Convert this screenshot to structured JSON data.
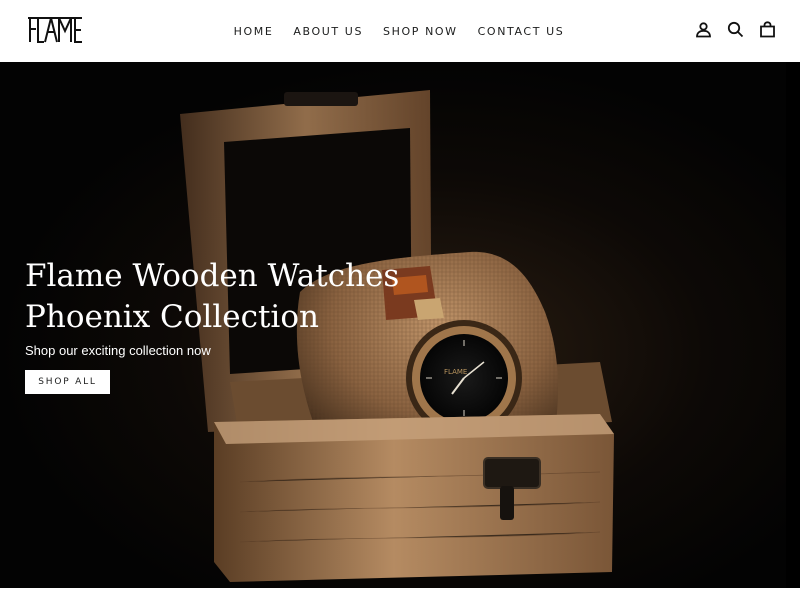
{
  "brand": {
    "logo_text": "FLAME",
    "logo_icon": "flame-logo"
  },
  "nav": {
    "items": [
      {
        "label": "HOME"
      },
      {
        "label": "ABOUT US"
      },
      {
        "label": "SHOP NOW"
      },
      {
        "label": "CONTACT US"
      }
    ]
  },
  "header_icons": [
    "user-icon",
    "search-icon",
    "cart-icon"
  ],
  "hero": {
    "title_line1": "Flame Wooden Watches",
    "title_line2": "Phoenix Collection",
    "subtitle": "Shop our exciting collection now",
    "button_label": "SHOP ALL",
    "image_subject": "wooden-watch-in-wooden-box-photo",
    "watch_dial_brand": "FLAME"
  },
  "colors": {
    "header_bg": "#ffffff",
    "hero_bg": "#050505",
    "text_dark": "#1c1d1d",
    "text_light": "#ffffff",
    "wood": "#a87e55",
    "burlap": "#9a7350"
  }
}
